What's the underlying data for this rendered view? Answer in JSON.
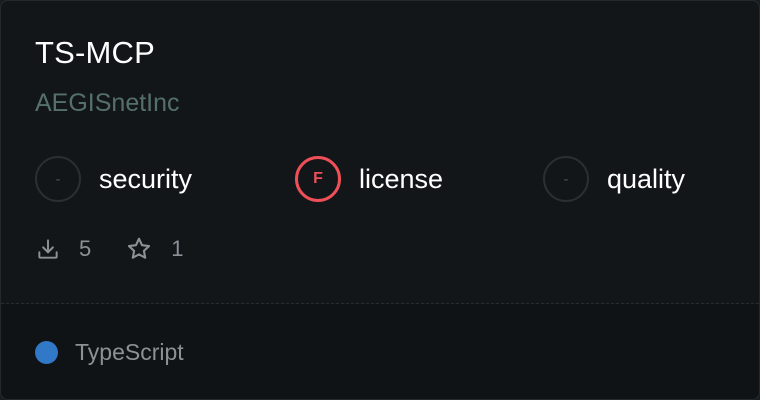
{
  "card": {
    "title": "TS-MCP",
    "org": "AEGISnetInc",
    "scores": [
      {
        "label": "security",
        "grade": "-"
      },
      {
        "label": "license",
        "grade": "F"
      },
      {
        "label": "quality",
        "grade": "-"
      }
    ],
    "stats": {
      "downloads": "5",
      "downloads_icon": "download-icon",
      "stars": "1",
      "stars_icon": "star-icon"
    },
    "language": {
      "name": "TypeScript",
      "color": "#3178c6"
    }
  },
  "colors": {
    "grade_f": "#ef4f57",
    "org_text": "#55706b"
  }
}
